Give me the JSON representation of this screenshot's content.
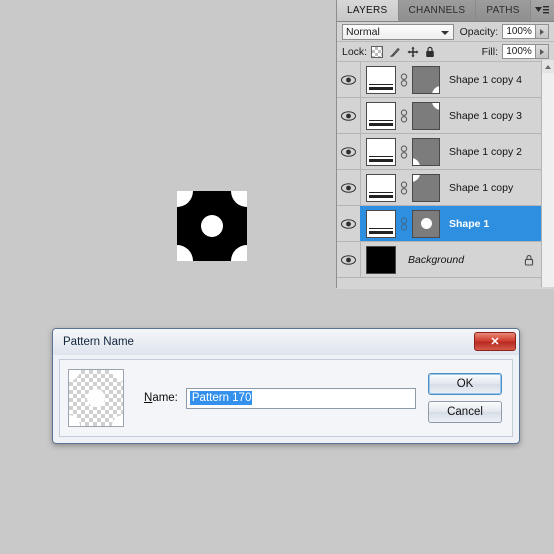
{
  "canvas": {
    "artwork_name": "pattern-tile-preview",
    "background_color": "#c9c9c9",
    "shape_fill": "#000000",
    "cut_color": "#ffffff"
  },
  "layers_panel": {
    "tabs": [
      {
        "label": "LAYERS",
        "active": true
      },
      {
        "label": "CHANNELS",
        "active": false
      },
      {
        "label": "PATHS",
        "active": false
      }
    ],
    "menu_icon": "panel-menu-icon",
    "blend_mode": "Normal",
    "opacity_label": "Opacity:",
    "opacity_value": "100%",
    "fill_label": "Fill:",
    "fill_value": "100%",
    "lock_label": "Lock:",
    "lock_icons": [
      "lock-transparent-pixels-icon",
      "lock-image-pixels-icon",
      "lock-position-icon",
      "lock-all-icon"
    ],
    "selection_color": "#2e8fe0",
    "layers": [
      {
        "name": "Shape 1 copy 4",
        "mask": "corner-br",
        "visible": true,
        "selected": false,
        "locked": false,
        "italic": false
      },
      {
        "name": "Shape 1 copy 3",
        "mask": "corner-tr",
        "visible": true,
        "selected": false,
        "locked": false,
        "italic": false
      },
      {
        "name": "Shape 1 copy 2",
        "mask": "corner-bl",
        "visible": true,
        "selected": false,
        "locked": false,
        "italic": false
      },
      {
        "name": "Shape 1 copy",
        "mask": "corner-tl",
        "visible": true,
        "selected": false,
        "locked": false,
        "italic": false
      },
      {
        "name": "Shape 1",
        "mask": "circle",
        "visible": true,
        "selected": true,
        "locked": false,
        "italic": false
      },
      {
        "name": "Background",
        "mask": "none",
        "visible": true,
        "selected": false,
        "locked": true,
        "italic": true
      }
    ]
  },
  "dialog": {
    "title": "Pattern Name",
    "close_label": "✕",
    "preview_name": "pattern-preview-thumbnail",
    "name_label_prefix": "N",
    "name_label_rest": "ame:",
    "name_value": "Pattern 170",
    "ok_label": "OK",
    "cancel_label": "Cancel"
  }
}
